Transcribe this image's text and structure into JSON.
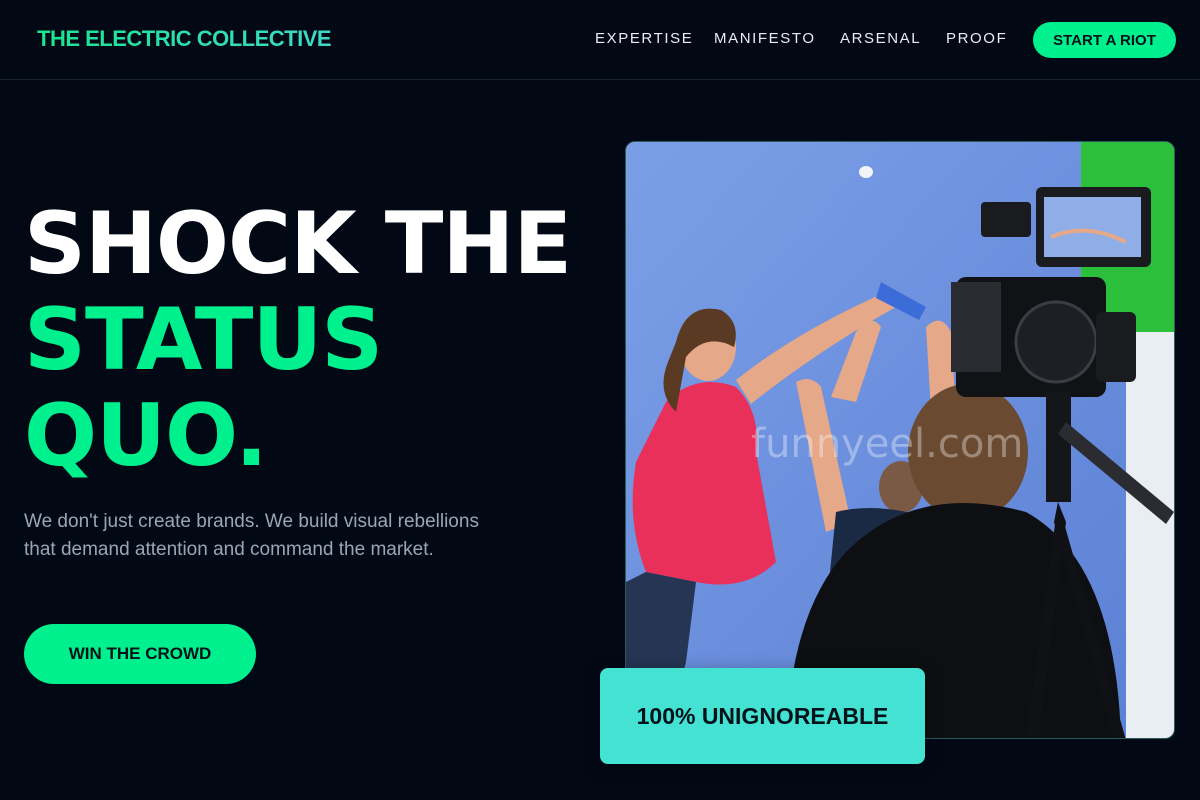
{
  "brand": {
    "name": "THE ELECTRIC COLLECTIVE"
  },
  "nav": {
    "links": [
      "EXPERTISE",
      "MANIFESTO",
      "ARSENAL",
      "PROOF"
    ],
    "cta": "START A RIOT"
  },
  "hero": {
    "headline_line1": "SHOCK THE",
    "headline_line2": "STATUS",
    "headline_line3": "QUO.",
    "lede": "We don't just create brands. We build visual rebellions that demand attention and command the market.",
    "cta": "WIN THE CROWD",
    "badge": "100% UNIGNOREABLE",
    "image_watermark": "funnyeel.com"
  },
  "colors": {
    "background": "#020915",
    "accent": "#00f08e",
    "badge": "#43e2d3",
    "muted_text": "#9aa6b4"
  }
}
